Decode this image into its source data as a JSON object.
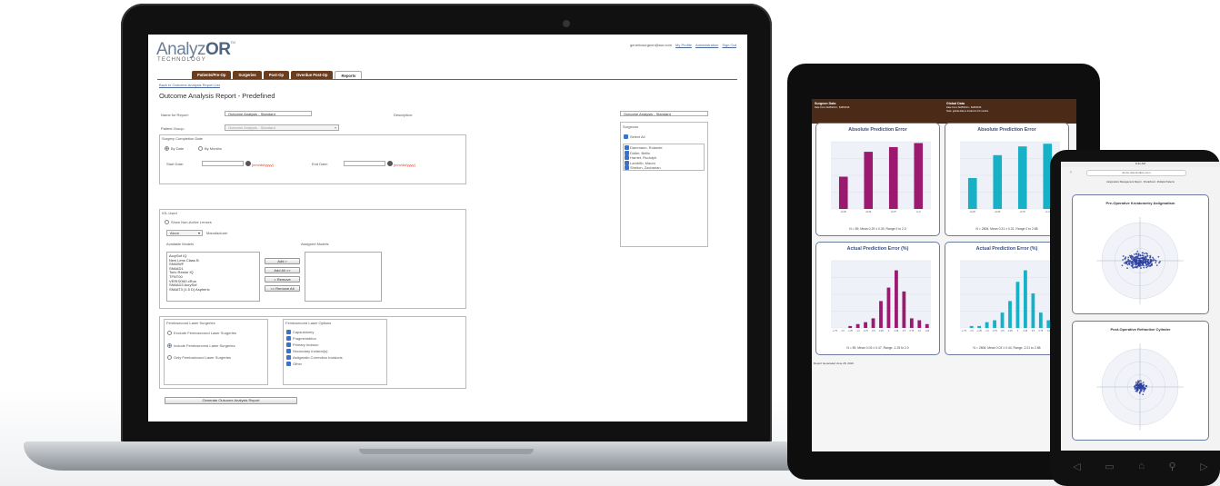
{
  "app": {
    "logo_main": "Analyz",
    "logo_bold": "OR",
    "logo_tm": "TM",
    "logo_sub": "TECHNOLOGY",
    "user_email": "genericsurgeon@aor.com",
    "link_profile": "My Profile",
    "link_admin": "Administration",
    "link_signout": "Sign Out",
    "tabs": [
      "Patients/Pre-Op",
      "Surgeries",
      "Post-Op",
      "Overdue Post-Op",
      "Reports"
    ],
    "active_tab": "Reports",
    "breadcrumb": "Back to Outcome Analysis Report List",
    "page_title": "Outcome Analysis Report - Predefined"
  },
  "form": {
    "name_label": "Name for Report:",
    "name_value": "Outcome Analysis - Standard",
    "description_label": "Description:",
    "description_value": "Outcome Analysis - Standard",
    "patient_group_label": "Patient Group:",
    "patient_group_value": "Outcome Analysis - Standard",
    "date_section": "Surgery Completion Date",
    "by_date": "By Date",
    "by_months": "By Months",
    "start_label": "Start Date:",
    "end_label": "End Date:",
    "date_placeholder": "[mm/dd/yyyy]",
    "surgeons_label": "Surgeons",
    "select_all": "Select All",
    "surgeons": [
      "Dammann, Rolande",
      "Didier, Bellis",
      "Harriet, Rudolph",
      "Landrith, Mauro",
      "Shelton, Zacharian"
    ],
    "iol_section": "IOL Used",
    "show_lenses": "Show Non-Active Lenses",
    "manufacturer_value": "Alcon",
    "manufacturer_label": "Manufacturer",
    "available_label": "Available Models",
    "assigned_label": "Assigned Models",
    "models": [
      "AcrySof IQ",
      "New Lens Class B",
      "SN60WF",
      "SN6AD1",
      "Toric Restor IQ",
      "TFNT00",
      "VERISO60 cRun",
      "SN6AD3 AcrySof",
      "SN6AT3 (1.5 D) Aspheric"
    ],
    "btn_add": "Add >",
    "btn_add_all": "Add All >>",
    "btn_remove": "< Remove",
    "btn_remove_all": "<< Remove All",
    "femto_section": "Femtosecond Laser Surgeries",
    "femto_options": [
      "Exclude Femtosecond Laser Surgeries",
      "Include Femtosecond Laser Surgeries",
      "Only Femtosecond Laser Surgeries"
    ],
    "femto_laser_section": "Femtosecond Laser Options",
    "laser_options": [
      "Capsulotomy",
      "Fragmentation",
      "Primary Incision",
      "Secondary Incision(s)",
      "Astigmatic Correction Incisions",
      "Other"
    ],
    "generate_button": "Generate Outcome Analysis Report"
  },
  "tablet": {
    "left_head_title": "Surgeon Data",
    "left_head_sub": "Date From 6/28/2014 - 6/28/2016",
    "right_head_title": "Global Data",
    "right_head_sub": "Date From 6/28/2014 - 6/28/2016",
    "right_head_note": "Note: global data is limited to 15 months",
    "cards": [
      {
        "title": "Absolute Prediction Error",
        "footer": "N = 89, Mean 0.29 ± 0.30, Range 0 to 2.0"
      },
      {
        "title": "Absolute Prediction Error",
        "footer": "N = 2806, Mean 0.31 ± 0.31, Range 0 to 2.88"
      },
      {
        "title": "Actual Prediction Error (%)",
        "footer": "N = 89, Mean 0.03 ± 0.47, Range -1.25 to 2.0"
      },
      {
        "title": "Actual Prediction Error (%)",
        "footer": "N = 2806, Mean 0.03 ± 0.44, Range -2.21 to 2.88"
      }
    ],
    "report_generated": "Report Generated June 28, 2016"
  },
  "phone": {
    "status_time": "9:41 AM",
    "url": "demo.visionmdpro.com",
    "subtitle": "Astigmatism Management Report - Predefined - Multiple Patients",
    "card1_title": "Pre-Operative Keratometry Astigmatism",
    "card2_title": "Post-Operative Refractive Cylinder"
  },
  "colors": {
    "brown_tab": "#6a3d1e",
    "purple_bar": "#9b1a6f",
    "cyan_bar": "#17b1c7",
    "scatter": "#2d3f9e"
  },
  "chart_data": [
    {
      "type": "bar",
      "title": "Absolute Prediction Error",
      "categories": [
        "≤0.25",
        "≤0.50",
        "≤0.75",
        "≤1.0"
      ],
      "values": [
        48,
        85,
        92,
        98
      ],
      "ylim": [
        0,
        100
      ]
    },
    {
      "type": "bar",
      "title": "Absolute Prediction Error",
      "categories": [
        "≤0.25",
        "≤0.50",
        "≤0.75",
        "≤1.0"
      ],
      "values": [
        46,
        80,
        93,
        97
      ],
      "ylim": [
        0,
        100
      ]
    },
    {
      "type": "bar",
      "title": "Actual Prediction Error (%)",
      "categories": [
        "-1.75",
        "-1.5",
        "-1.25",
        "-1.0",
        "-0.75",
        "-0.5",
        "-0.25",
        "0",
        "0.25",
        "0.5",
        "0.75",
        "1.0",
        "1.25"
      ],
      "values": [
        0,
        0,
        1,
        2,
        3,
        5,
        14,
        21,
        30,
        19,
        5,
        4,
        2
      ],
      "ylim": [
        0,
        35
      ]
    },
    {
      "type": "bar",
      "title": "Actual Prediction Error (%)",
      "categories": [
        "-1.75",
        "-1.5",
        "-1.25",
        "-1.0",
        "-0.75",
        "-0.5",
        "-0.25",
        "0",
        "0.25",
        "0.5",
        "0.75",
        "1.0",
        "1.25"
      ],
      "values": [
        0,
        1,
        1,
        3,
        4,
        8,
        14,
        24,
        30,
        18,
        8,
        4,
        1
      ],
      "ylim": [
        0,
        35
      ]
    }
  ]
}
